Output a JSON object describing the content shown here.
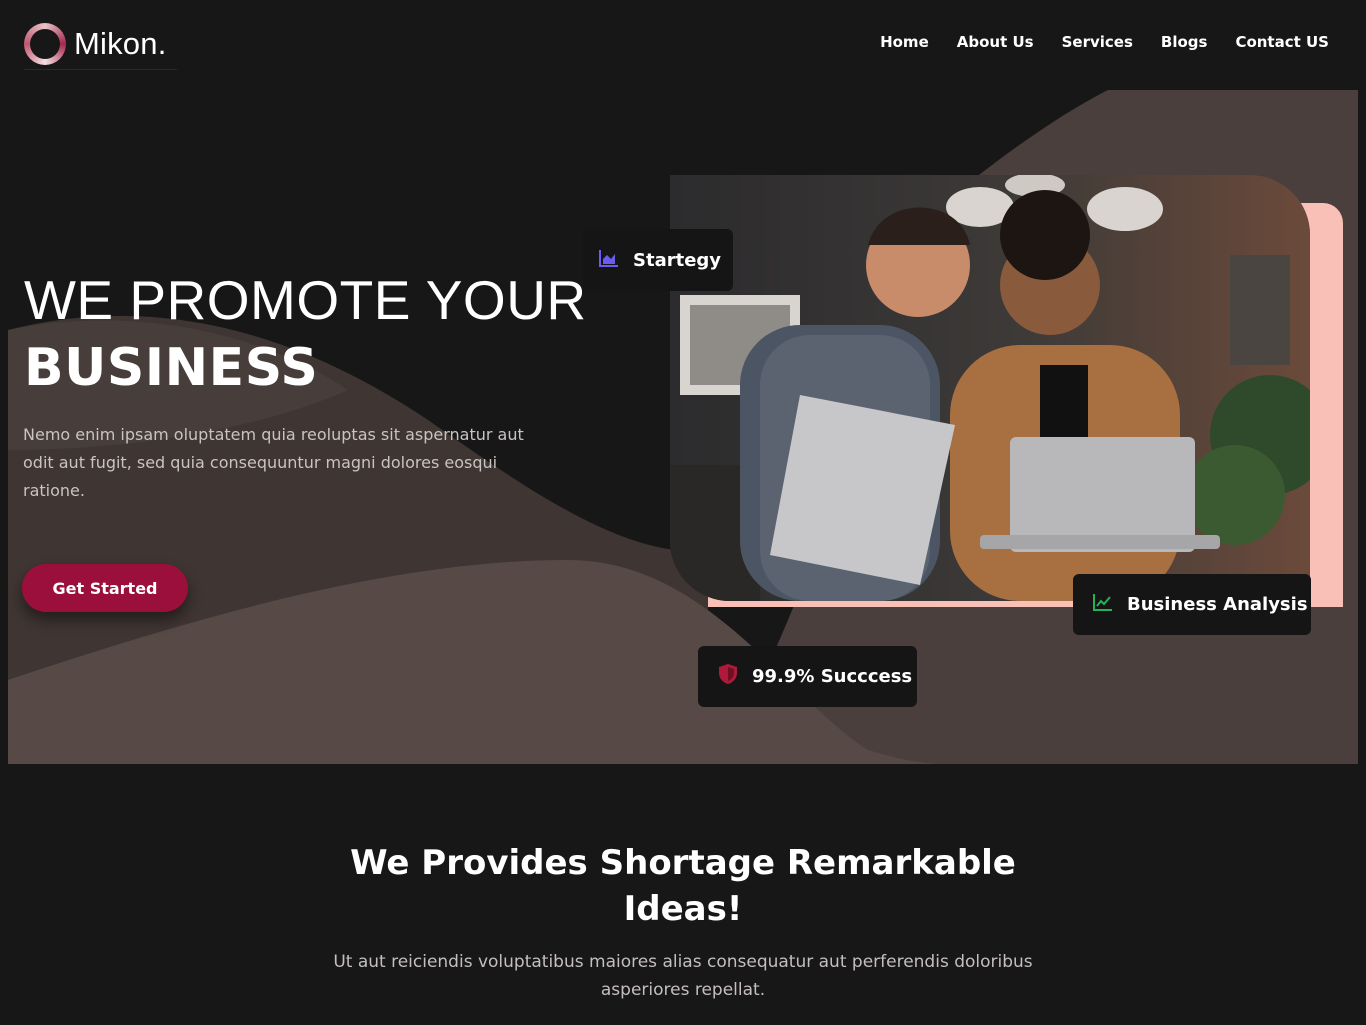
{
  "header": {
    "logo_text": "Mikon.",
    "nav": [
      "Home",
      "About Us",
      "Services",
      "Blogs",
      "Contact US"
    ]
  },
  "hero": {
    "title_line1": "WE PROMOTE YOUR",
    "title_line2": "BUSINESS",
    "description": "Nemo enim ipsam oluptatem quia reoluptas sit aspernatur aut odit aut fugit, sed quia consequuntur magni dolores eosqui ratione.",
    "cta_label": "Get Started",
    "badges": {
      "strategy": {
        "label": "Startegy",
        "icon": "area-chart-icon"
      },
      "analysis": {
        "label": "Business Analysis",
        "icon": "line-chart-icon"
      },
      "success": {
        "label": "99.9% Succcess",
        "icon": "shield-icon"
      }
    }
  },
  "section": {
    "title_line1": "We Provides Shortage Remarkable",
    "title_line2": "Ideas!",
    "desc_line1": "Ut aut reiciendis voluptatibus maiores alias consequatur aut perferendis doloribus",
    "desc_line2": "asperiores repellat."
  },
  "colors": {
    "background": "#181718",
    "wave_dark": "#3b3230",
    "wave_mid": "#4a3f3c",
    "accent_button": "#9b0f3d",
    "photo_accent": "#f8c0b6",
    "strategy_icon": "#6a5cf0",
    "analysis_icon": "#22b35a",
    "success_icon": "#b01a3a"
  }
}
